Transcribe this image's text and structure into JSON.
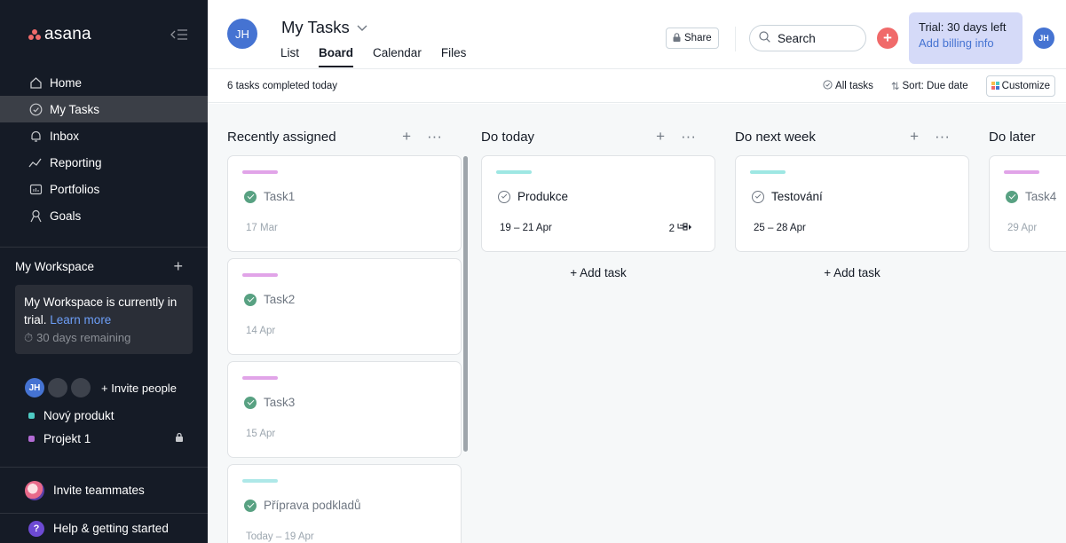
{
  "app": {
    "name": "asana"
  },
  "sidebar": {
    "nav": [
      {
        "label": "Home"
      },
      {
        "label": "My Tasks"
      },
      {
        "label": "Inbox"
      },
      {
        "label": "Reporting"
      },
      {
        "label": "Portfolios"
      },
      {
        "label": "Goals"
      }
    ],
    "workspace": {
      "title": "My Workspace",
      "trial_text": "My Workspace is currently in trial.",
      "learn_more": "Learn more",
      "remaining": "30 days remaining"
    },
    "user_initials": "JH",
    "invite_people": "+ Invite people",
    "projects": [
      {
        "name": "Nový produkt",
        "color": "#4ecbc4"
      },
      {
        "name": "Projekt 1",
        "color": "#b36bd4"
      }
    ],
    "invite_teammates": "Invite teammates",
    "help": "Help & getting started"
  },
  "header": {
    "avatar": "JH",
    "title": "My Tasks",
    "tabs": [
      "List",
      "Board",
      "Calendar",
      "Files"
    ],
    "share": "Share",
    "search": "Search",
    "trial_line1": "Trial: 30 days left",
    "trial_line2": "Add billing info",
    "user_avatar": "JH"
  },
  "toolbar": {
    "completed": "6 tasks completed today",
    "all_tasks": "All tasks",
    "sort": "Sort: Due date",
    "customize": "Customize"
  },
  "board": {
    "columns": [
      {
        "title": "Recently assigned",
        "cards": [
          {
            "name": "Task1",
            "date": "17 Mar",
            "done": true,
            "color": "#e1a4e8"
          },
          {
            "name": "Task2",
            "date": "14 Apr",
            "done": true,
            "color": "#e1a4e8"
          },
          {
            "name": "Task3",
            "date": "15 Apr",
            "done": true,
            "color": "#e1a4e8"
          },
          {
            "name": "Příprava podkladů",
            "date": "Today – 19 Apr",
            "done": true,
            "color": "#aee8e8"
          }
        ]
      },
      {
        "title": "Do today",
        "cards": [
          {
            "name": "Produkce",
            "date": "19 – 21 Apr",
            "done": false,
            "color": "#9ee7e3",
            "subtasks": "2"
          }
        ],
        "add_task": "+ Add task"
      },
      {
        "title": "Do next week",
        "cards": [
          {
            "name": "Testování",
            "date": "25 – 28 Apr",
            "done": false,
            "color": "#9ee7e3"
          }
        ],
        "add_task": "+ Add task"
      },
      {
        "title": "Do later",
        "cards": [
          {
            "name": "Task4",
            "date": "29 Apr",
            "done": true,
            "color": "#e1a4e8"
          }
        ]
      }
    ]
  }
}
